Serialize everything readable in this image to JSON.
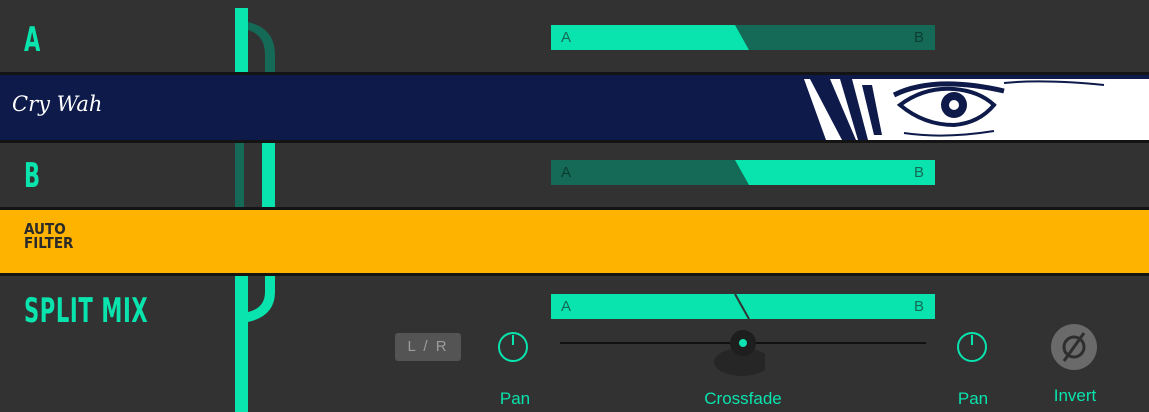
{
  "sections": {
    "a": {
      "title": "A",
      "bar_left": "A",
      "bar_right": "B",
      "mix": 0.5
    },
    "crywah": {
      "title": "Cry Wah"
    },
    "b": {
      "title": "B",
      "bar_left": "A",
      "bar_right": "B",
      "mix": 0.5
    },
    "autofilter": {
      "title_line1": "AUTO",
      "title_line2": "FILTER"
    },
    "split_mix": {
      "title": "SPLIT MIX",
      "bar_left": "A",
      "bar_right": "B",
      "lr_button": "L / R",
      "pan_left_label": "Pan",
      "crossfade_label": "Crossfade",
      "crossfade_value": 0.5,
      "pan_right_label": "Pan",
      "invert_label": "Invert"
    }
  },
  "colors": {
    "accent": "#09e3ad",
    "accent_dark": "#156a57",
    "background": "#323232",
    "crywah_bg": "#0e1a4a",
    "autofilter_bg": "#fdb300",
    "separator": "#141414"
  },
  "icons": {
    "pan_knob": "knob-icon",
    "invert": "phase-invert-icon",
    "crywah_art": "eye-illustration"
  }
}
